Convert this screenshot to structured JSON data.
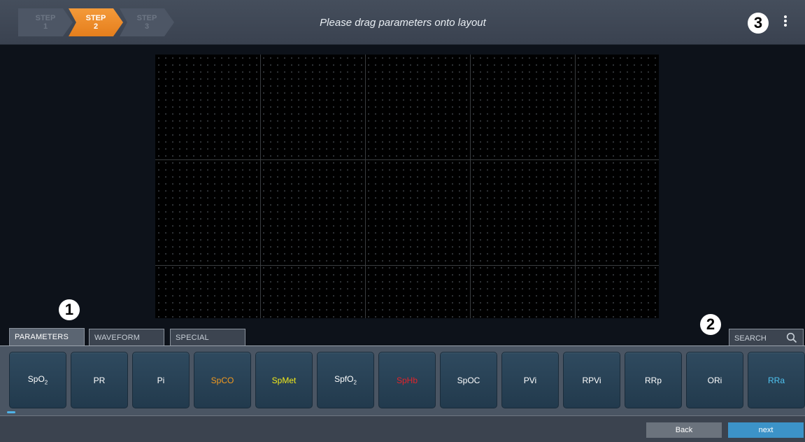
{
  "header": {
    "steps": [
      {
        "word": "STEP",
        "number": "1",
        "state": "inactive"
      },
      {
        "word": "STEP",
        "number": "2",
        "state": "active"
      },
      {
        "word": "STEP",
        "number": "3",
        "state": "inactive"
      }
    ],
    "title": "Please drag parameters onto layout",
    "callout": "3"
  },
  "callouts": {
    "one": "1",
    "two": "2"
  },
  "tabs": [
    {
      "label": "PARAMETERS",
      "active": true
    },
    {
      "label": "WAVEFORM",
      "active": false
    },
    {
      "label": "SPECIAL",
      "active": false
    }
  ],
  "search": {
    "label": "SEARCH"
  },
  "parameters": [
    {
      "base": "SpO",
      "sub": "2",
      "color": "#ffffff"
    },
    {
      "base": "PR",
      "sub": "",
      "color": "#ffffff"
    },
    {
      "base": "Pi",
      "sub": "",
      "color": "#ffffff"
    },
    {
      "base": "SpCO",
      "sub": "",
      "color": "#f39a1e"
    },
    {
      "base": "SpMet",
      "sub": "",
      "color": "#f2ea1a"
    },
    {
      "base": "SpfO",
      "sub": "2",
      "color": "#ffffff"
    },
    {
      "base": "SpHb",
      "sub": "",
      "color": "#e5232a"
    },
    {
      "base": "SpOC",
      "sub": "",
      "color": "#ffffff"
    },
    {
      "base": "PVi",
      "sub": "",
      "color": "#ffffff"
    },
    {
      "base": "RPVi",
      "sub": "",
      "color": "#ffffff"
    },
    {
      "base": "RRp",
      "sub": "",
      "color": "#ffffff"
    },
    {
      "base": "ORi",
      "sub": "",
      "color": "#ffffff"
    },
    {
      "base": "RRa",
      "sub": "",
      "color": "#4fc3f0"
    }
  ],
  "footer": {
    "back_label": "Back",
    "next_label": "next"
  }
}
